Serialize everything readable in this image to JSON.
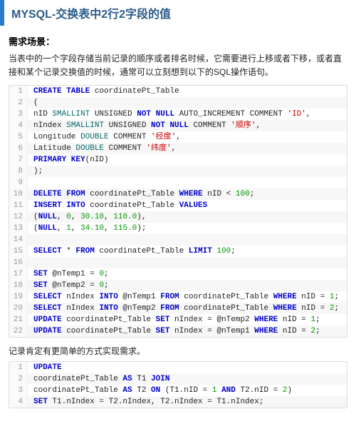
{
  "title": "MYSQL-交换表中2行2字段的值",
  "section_heading": "需求场景：",
  "intro_para": "当表中的一个字段存储当前记录的顺序或者排名时候，它需要进行上移或者下移，或者直接和某个记录交换值的时候，通常可以立刻想到以下的SQL操作语句。",
  "note": "记录肯定有更简单的方式实现需求。",
  "code1": [
    {
      "n": "1",
      "t": [
        [
          "kw",
          "CREATE TABLE"
        ],
        [
          "fn",
          " coordinatePt_Table"
        ]
      ]
    },
    {
      "n": "2",
      "t": [
        [
          "fn",
          "("
        ]
      ]
    },
    {
      "n": "3",
      "t": [
        [
          "fn",
          "nID "
        ],
        [
          "ty",
          "SMALLINT"
        ],
        [
          "fn",
          " UNSIGNED "
        ],
        [
          "kw",
          "NOT NULL"
        ],
        [
          "fn",
          " AUTO_INCREMENT COMMENT "
        ],
        [
          "str",
          "'ID'"
        ],
        [
          "fn",
          ","
        ]
      ]
    },
    {
      "n": "4",
      "t": [
        [
          "fn",
          "nIndex "
        ],
        [
          "ty",
          "SMALLINT"
        ],
        [
          "fn",
          " UNSIGNED "
        ],
        [
          "kw",
          "NOT NULL"
        ],
        [
          "fn",
          " COMMENT "
        ],
        [
          "str",
          "'顺序'"
        ],
        [
          "fn",
          ","
        ]
      ]
    },
    {
      "n": "5",
      "t": [
        [
          "fn",
          "Longitude "
        ],
        [
          "ty",
          "DOUBLE"
        ],
        [
          "fn",
          " COMMENT "
        ],
        [
          "str",
          "'经度'"
        ],
        [
          "fn",
          ","
        ]
      ]
    },
    {
      "n": "6",
      "t": [
        [
          "fn",
          "Latitude "
        ],
        [
          "ty",
          "DOUBLE"
        ],
        [
          "fn",
          " COMMENT "
        ],
        [
          "str",
          "'纬度'"
        ],
        [
          "fn",
          ","
        ]
      ]
    },
    {
      "n": "7",
      "t": [
        [
          "kw",
          "PRIMARY KEY"
        ],
        [
          "fn",
          "(nID)"
        ]
      ]
    },
    {
      "n": "8",
      "t": [
        [
          "fn",
          ");"
        ]
      ]
    },
    {
      "n": "9",
      "t": []
    },
    {
      "n": "10",
      "t": [
        [
          "kw",
          "DELETE FROM"
        ],
        [
          "fn",
          " coordinatePt_Table "
        ],
        [
          "kw",
          "WHERE"
        ],
        [
          "fn",
          " nID < "
        ],
        [
          "num",
          "100"
        ],
        [
          "fn",
          ";"
        ]
      ]
    },
    {
      "n": "11",
      "t": [
        [
          "kw",
          "INSERT INTO"
        ],
        [
          "fn",
          " coordinatePt_Table "
        ],
        [
          "kw",
          "VALUES"
        ]
      ]
    },
    {
      "n": "12",
      "t": [
        [
          "fn",
          "("
        ],
        [
          "kw",
          "NULL"
        ],
        [
          "fn",
          ", "
        ],
        [
          "num",
          "0"
        ],
        [
          "fn",
          ", "
        ],
        [
          "num",
          "30.10"
        ],
        [
          "fn",
          ", "
        ],
        [
          "num",
          "110.0"
        ],
        [
          "fn",
          "),"
        ]
      ]
    },
    {
      "n": "13",
      "t": [
        [
          "fn",
          "("
        ],
        [
          "kw",
          "NULL"
        ],
        [
          "fn",
          ", "
        ],
        [
          "num",
          "1"
        ],
        [
          "fn",
          ", "
        ],
        [
          "num",
          "34.10"
        ],
        [
          "fn",
          ", "
        ],
        [
          "num",
          "115.0"
        ],
        [
          "fn",
          ");"
        ]
      ]
    },
    {
      "n": "14",
      "t": []
    },
    {
      "n": "15",
      "t": [
        [
          "kw",
          "SELECT"
        ],
        [
          "fn",
          " * "
        ],
        [
          "kw",
          "FROM"
        ],
        [
          "fn",
          " coordinatePt_Table "
        ],
        [
          "kw",
          "LIMIT"
        ],
        [
          "fn",
          " "
        ],
        [
          "num",
          "100"
        ],
        [
          "fn",
          ";"
        ]
      ]
    },
    {
      "n": "16",
      "t": []
    },
    {
      "n": "17",
      "t": [
        [
          "kw",
          "SET"
        ],
        [
          "fn",
          " @nTemp1 = "
        ],
        [
          "num",
          "0"
        ],
        [
          "fn",
          ";"
        ]
      ]
    },
    {
      "n": "18",
      "t": [
        [
          "kw",
          "SET"
        ],
        [
          "fn",
          " @nTemp2 = "
        ],
        [
          "num",
          "0"
        ],
        [
          "fn",
          ";"
        ]
      ]
    },
    {
      "n": "19",
      "t": [
        [
          "kw",
          "SELECT"
        ],
        [
          "fn",
          " nIndex "
        ],
        [
          "kw",
          "INTO"
        ],
        [
          "fn",
          " @nTemp1 "
        ],
        [
          "kw",
          "FROM"
        ],
        [
          "fn",
          " coordinatePt_Table "
        ],
        [
          "kw",
          "WHERE"
        ],
        [
          "fn",
          " nID = "
        ],
        [
          "num",
          "1"
        ],
        [
          "fn",
          ";"
        ]
      ]
    },
    {
      "n": "20",
      "t": [
        [
          "kw",
          "SELECT"
        ],
        [
          "fn",
          " nIndex "
        ],
        [
          "kw",
          "INTO"
        ],
        [
          "fn",
          " @nTemp2 "
        ],
        [
          "kw",
          "FROM"
        ],
        [
          "fn",
          " coordinatePt_Table "
        ],
        [
          "kw",
          "WHERE"
        ],
        [
          "fn",
          " nID = "
        ],
        [
          "num",
          "2"
        ],
        [
          "fn",
          ";"
        ]
      ]
    },
    {
      "n": "21",
      "t": [
        [
          "kw",
          "UPDATE"
        ],
        [
          "fn",
          " coordinatePt_Table "
        ],
        [
          "kw",
          "SET"
        ],
        [
          "fn",
          " nIndex = @nTemp2 "
        ],
        [
          "kw",
          "WHERE"
        ],
        [
          "fn",
          " nID = "
        ],
        [
          "num",
          "1"
        ],
        [
          "fn",
          ";"
        ]
      ]
    },
    {
      "n": "22",
      "t": [
        [
          "kw",
          "UPDATE"
        ],
        [
          "fn",
          " coordinatePt_Table "
        ],
        [
          "kw",
          "SET"
        ],
        [
          "fn",
          " nIndex = @nTemp1 "
        ],
        [
          "kw",
          "WHERE"
        ],
        [
          "fn",
          " nID = "
        ],
        [
          "num",
          "2"
        ],
        [
          "fn",
          ";"
        ]
      ]
    }
  ],
  "code2": [
    {
      "n": "1",
      "t": [
        [
          "kw",
          "UPDATE"
        ]
      ]
    },
    {
      "n": "2",
      "t": [
        [
          "fn",
          "coordinatePt_Table "
        ],
        [
          "kw",
          "AS"
        ],
        [
          "fn",
          " T1 "
        ],
        [
          "kw",
          "JOIN"
        ]
      ]
    },
    {
      "n": "3",
      "t": [
        [
          "fn",
          "coordinatePt_Table "
        ],
        [
          "kw",
          "AS"
        ],
        [
          "fn",
          " T2 "
        ],
        [
          "kw",
          "ON"
        ],
        [
          "fn",
          " (T1.nID = "
        ],
        [
          "num",
          "1"
        ],
        [
          "fn",
          " "
        ],
        [
          "kw",
          "AND"
        ],
        [
          "fn",
          " T2.nID = "
        ],
        [
          "num",
          "2"
        ],
        [
          "fn",
          ")"
        ]
      ]
    },
    {
      "n": "4",
      "t": [
        [
          "kw",
          "SET"
        ],
        [
          "fn",
          " T1.nIndex = T2.nIndex, T2.nIndex = T1.nIndex;"
        ]
      ]
    }
  ]
}
